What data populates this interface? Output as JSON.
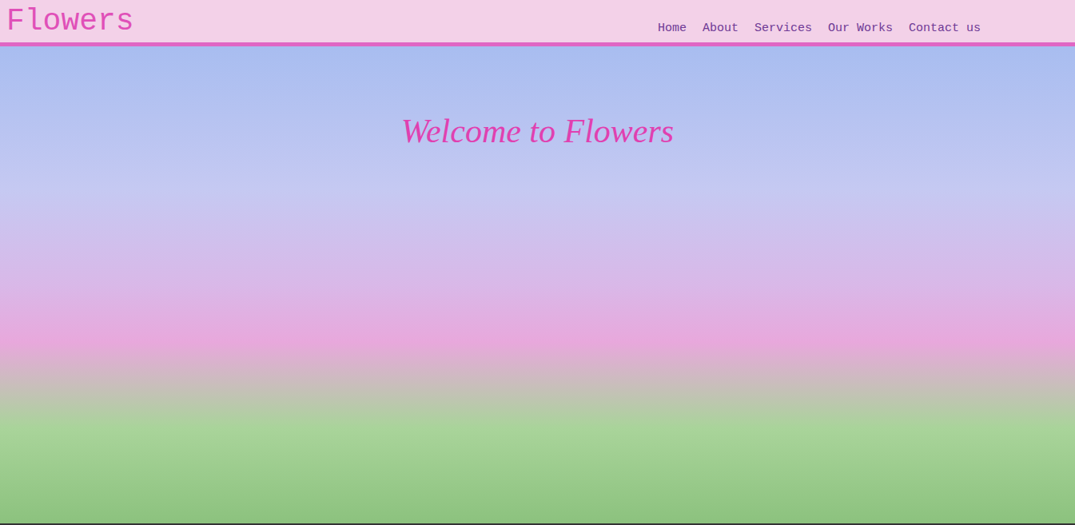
{
  "logo": "Flowers",
  "nav": [
    {
      "label": "Home"
    },
    {
      "label": "About"
    },
    {
      "label": "Services"
    },
    {
      "label": "Our Works"
    },
    {
      "label": "Contact us"
    }
  ],
  "hero": {
    "heading": "Welcome to Flowers"
  }
}
